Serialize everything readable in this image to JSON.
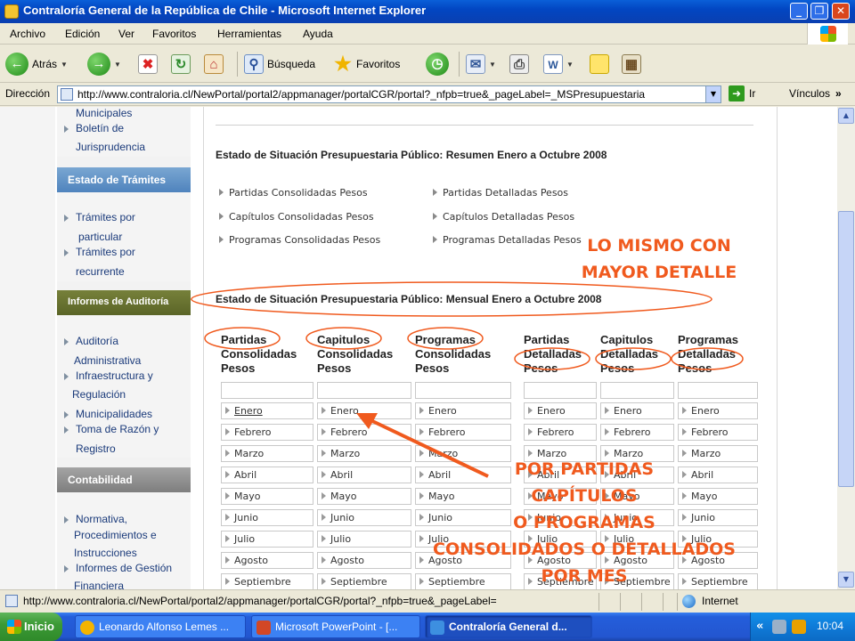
{
  "window": {
    "title": "Contraloría General de la República de Chile - Microsoft Internet Explorer",
    "minimize": "_",
    "maximize": "❐",
    "close": "✕"
  },
  "menu": [
    "Archivo",
    "Edición",
    "Ver",
    "Favoritos",
    "Herramientas",
    "Ayuda"
  ],
  "toolbar": {
    "back": "Atrás",
    "search": "Búsqueda",
    "favorites": "Favoritos"
  },
  "address": {
    "label": "Dirección",
    "url": "http://www.contraloria.cl/NewPortal/portal2/appmanager/portalCGR/portal?_nfpb=true&_pageLabel=_MSPresupuestaria",
    "go": "Ir",
    "links": "Vínculos"
  },
  "sidebar": {
    "top_items": [
      "Municipales",
      "Boletín de",
      "Jurisprudencia"
    ],
    "section1": {
      "title": "Estado de Trámites",
      "items": [
        "Trámites por",
        "particular",
        "Trámites por",
        "recurrente"
      ]
    },
    "section2": {
      "title": "Informes de Auditoría",
      "items": [
        "Auditoría",
        "Administrativa",
        "Infraestructura y",
        "Regulación",
        "Municipalidades",
        "Toma de Razón y",
        "Registro"
      ]
    },
    "section3": {
      "title": "Contabilidad",
      "items": [
        "Normativa,",
        "Procedimientos e",
        "Instrucciones",
        "Informes de Gestión",
        "Financiera"
      ]
    }
  },
  "content": {
    "summary_heading": "Estado de Situación Presupuestaria Público: Resumen Enero a Octubre 2008",
    "summary_links": [
      "Partidas Consolidadas Pesos",
      "Partidas Detalladas Pesos",
      "Capítulos Consolidadas Pesos",
      "Capítulos Detalladas Pesos",
      "Programas Consolidadas Pesos",
      "Programas Detalladas Pesos"
    ],
    "monthly_heading": "Estado de Situación Presupuestaria Público: Mensual Enero a Octubre 2008",
    "columns": [
      [
        "Partidas",
        "Consolidadas",
        "Pesos"
      ],
      [
        "Capitulos",
        "Consolidadas",
        "Pesos"
      ],
      [
        "Programas",
        "Consolidadas",
        "Pesos"
      ],
      [
        "Partidas",
        "Detalladas",
        "Pesos"
      ],
      [
        "Capitulos",
        "Detalladas",
        "Pesos"
      ],
      [
        "Programas",
        "Detalladas",
        "Pesos"
      ]
    ],
    "months": [
      "Enero",
      "Febrero",
      "Marzo",
      "Abril",
      "Mayo",
      "Junio",
      "Julio",
      "Agosto",
      "Septiembre"
    ]
  },
  "annotations": {
    "detail_note": [
      "LO MISMO CON",
      "MAYOR DETALLE"
    ],
    "month_note": [
      "POR PARTIDAS",
      "CAPÍTULOS",
      "O PROGRAMAS",
      "CONSOLIDADOS O DETALLADOS",
      "POR MES"
    ],
    "color": "#f05a1e"
  },
  "statusbar": {
    "url": "http://www.contraloria.cl/NewPortal/portal2/appmanager/portalCGR/portal?_nfpb=true&_pageLabel=",
    "zone": "Internet"
  },
  "taskbar": {
    "start": "Inicio",
    "tasks": [
      "Leonardo Alfonso Lemes ...",
      "Microsoft PowerPoint - [...",
      "Contraloría General d..."
    ],
    "tray_chevron": "«",
    "clock": "10:04"
  }
}
